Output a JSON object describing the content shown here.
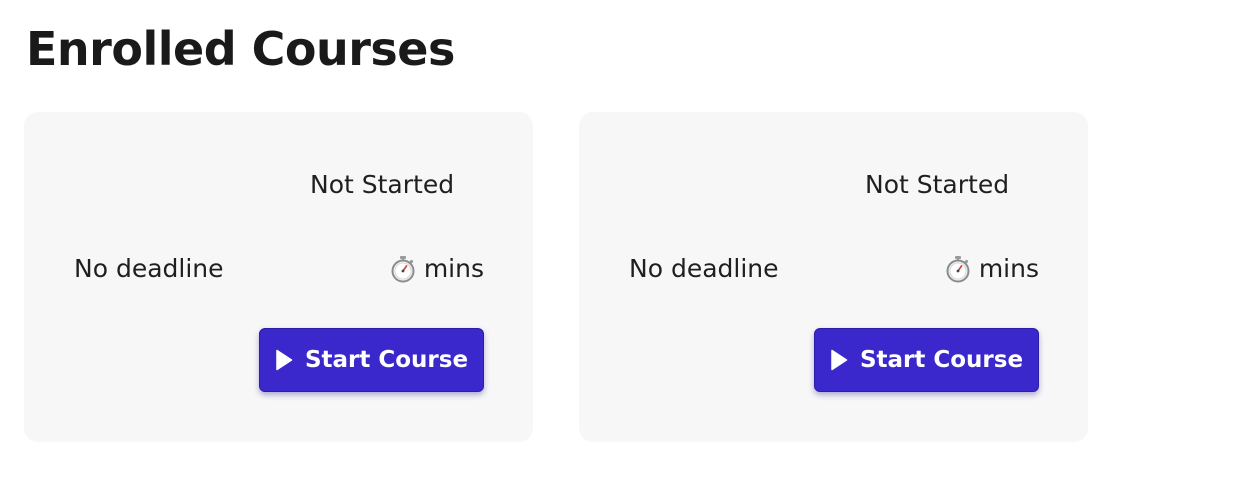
{
  "page": {
    "title": "Enrolled Courses"
  },
  "courses": [
    {
      "status": "Not Started",
      "deadline": "No deadline",
      "duration_unit": "mins",
      "duration_icon": "stopwatch-icon",
      "action_label": "Start Course",
      "action_icon": "play-icon"
    },
    {
      "status": "Not Started",
      "deadline": "No deadline",
      "duration_unit": "mins",
      "duration_icon": "stopwatch-icon",
      "action_label": "Start Course",
      "action_icon": "play-icon"
    }
  ],
  "colors": {
    "card_background": "#f7f7f7",
    "button_background": "#3b28cc",
    "button_text": "#ffffff",
    "text": "#1a1a1a"
  }
}
